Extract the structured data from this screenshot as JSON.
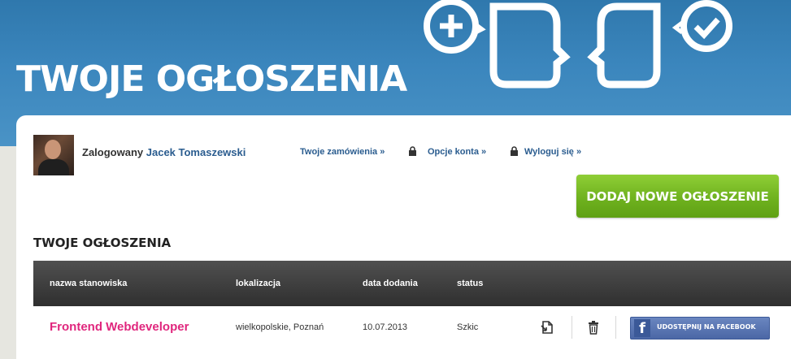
{
  "hero": {
    "title": "TWOJE OGŁOSZENIA",
    "icons": [
      "plus-circle-icon",
      "head-profile-right-icon",
      "head-profile-left-icon",
      "check-circle-icon"
    ]
  },
  "user": {
    "prefix": "Zalogowany",
    "name": "Jacek Tomaszewski"
  },
  "links": {
    "orders": "Twoje zamówienia »",
    "account": "Opcje konta »",
    "logout": "Wyloguj się »"
  },
  "add_button": "DODAJ NOWE OGŁOSZENIE",
  "section_title": "TWOJE OGŁOSZENIA",
  "table": {
    "headers": [
      "nazwa stanowiska",
      "lokalizacja",
      "data dodania",
      "status"
    ],
    "rows": [
      {
        "title": "Frontend Webdeveloper",
        "location": "wielkopolskie, Poznań",
        "date": "10.07.2013",
        "status": "Szkic",
        "share_label": "UDOSTĘPNIJ NA FACEBOOK"
      }
    ]
  },
  "colors": {
    "hero_blue": "#3b86bd",
    "link_blue": "#2a5c8f",
    "accent_pink": "#e0267d",
    "button_green": "#6fb21f",
    "facebook_blue": "#3b5998"
  }
}
